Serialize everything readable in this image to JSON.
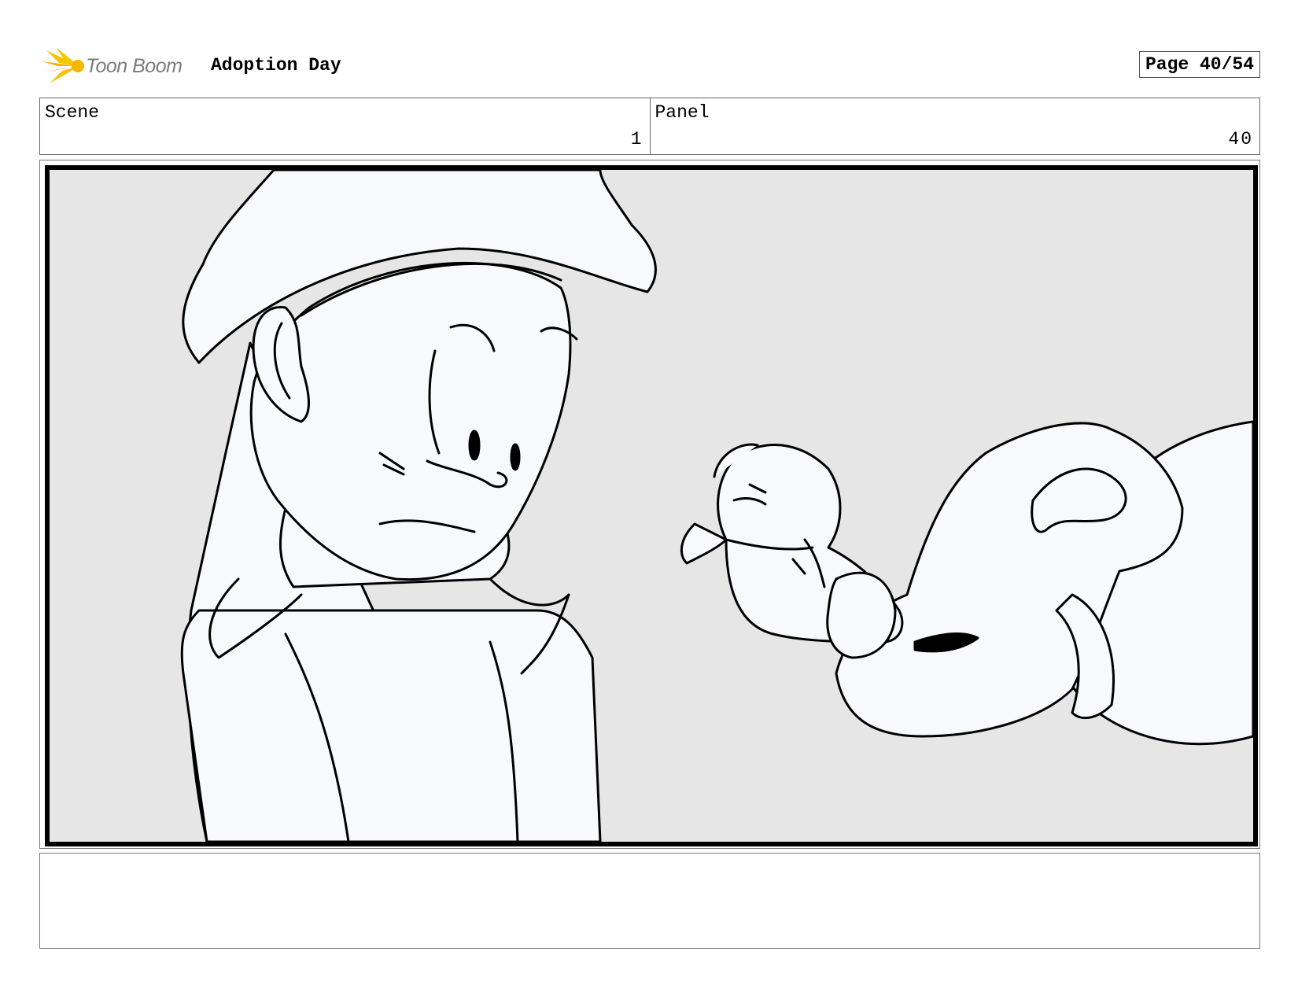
{
  "header": {
    "logo_text": "Toon Boom",
    "project_title": "Adoption Day",
    "page_label": "Page 40/54"
  },
  "info": {
    "scene_label": "Scene",
    "scene_value": "1",
    "panel_label": "Panel",
    "panel_value": "40"
  },
  "panel": {
    "background_color": "#e6e6e6",
    "line_color": "#000000",
    "fill_color": "#f8f9fc"
  },
  "logo": {
    "burst_colors": [
      "#f5c400",
      "#f29a00"
    ]
  },
  "notes": {
    "text": ""
  }
}
